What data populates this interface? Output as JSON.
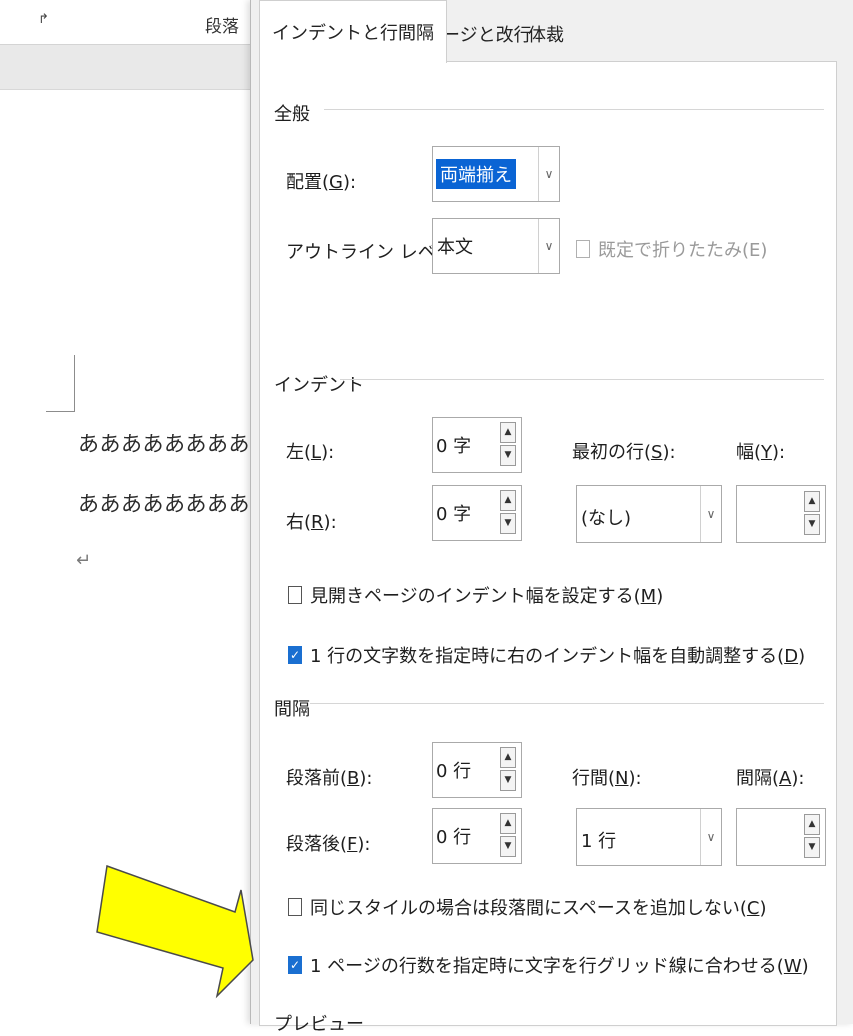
{
  "ribbon": {
    "launcher_icon": "dialog-launcher-icon",
    "group_label": "段落"
  },
  "document": {
    "lines": [
      "あああああああああぐ",
      "あああああああああぐ"
    ],
    "paragraph_mark": "↵"
  },
  "dialog": {
    "tabs": [
      {
        "label": "インデントと行間隔",
        "active": true
      },
      {
        "label": "改ページと改行",
        "active": false
      },
      {
        "label": "体裁",
        "active": false
      }
    ],
    "general": {
      "title": "全般",
      "alignment": {
        "label_pre": "配置(",
        "key": "G",
        "label_post": "):",
        "value": "両端揃え"
      },
      "outline": {
        "label_pre": "アウトライン レベル(",
        "key": "O",
        "label_post": "):",
        "value": "本文"
      },
      "collapse": {
        "label": "既定で折りたたみ(E)",
        "checked": false,
        "disabled": true
      }
    },
    "indent": {
      "title": "インデント",
      "left": {
        "label_pre": "左(",
        "key": "L",
        "label_post": "):",
        "value": "0 字"
      },
      "right": {
        "label_pre": "右(",
        "key": "R",
        "label_post": "):",
        "value": "0 字"
      },
      "first_line": {
        "label_pre": "最初の行(",
        "key": "S",
        "label_post": "):",
        "value": "(なし)"
      },
      "width": {
        "label_pre": "幅(",
        "key": "Y",
        "label_post": "):",
        "value": ""
      },
      "mirror": {
        "label_pre": "見開きページのインデント幅を設定する(",
        "key": "M",
        "label_post": ")",
        "checked": false
      },
      "auto_adjust": {
        "label_pre": "1 行の文字数を指定時に右のインデント幅を自動調整する(",
        "key": "D",
        "label_post": ")",
        "checked": true
      }
    },
    "spacing": {
      "title": "間隔",
      "before": {
        "label_pre": "段落前(",
        "key": "B",
        "label_post": "):",
        "value": "0 行"
      },
      "after": {
        "label_pre": "段落後(",
        "key": "F",
        "label_post": "):",
        "value": "0 行"
      },
      "line_spacing": {
        "label_pre": "行間(",
        "key": "N",
        "label_post": "):",
        "value": "1 行"
      },
      "at": {
        "label_pre": "間隔(",
        "key": "A",
        "label_post": "):",
        "value": ""
      },
      "no_space_same_style": {
        "label_pre": "同じスタイルの場合は段落間にスペースを追加しない(",
        "key": "C",
        "label_post": ")",
        "checked": false
      },
      "snap_to_grid": {
        "label_pre": "1 ページの行数を指定時に文字を行グリッド線に合わせる(",
        "key": "W",
        "label_post": ")",
        "checked": true
      }
    },
    "preview": {
      "title": "プレビュー"
    }
  },
  "colors": {
    "accent": "#1a6fd1",
    "selection": "#0a64d4",
    "arrow_fill": "#ffff00"
  }
}
